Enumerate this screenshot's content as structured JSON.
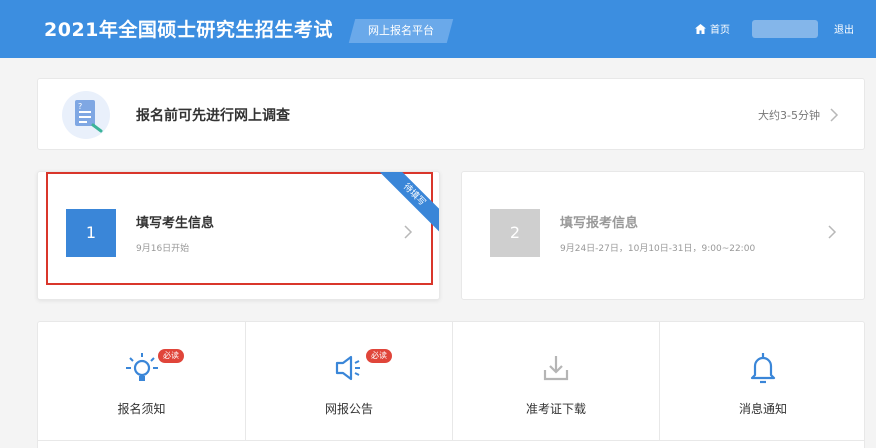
{
  "header": {
    "title": "2021年全国硕士研究生招生考试",
    "badge": "网上报名平台",
    "home": "首页",
    "logout": "退出",
    "bg_color": "#3c8ee0"
  },
  "survey": {
    "text": "报名前可先进行网上调查",
    "time": "大约3-5分钟",
    "icon": "survey-document-icon"
  },
  "steps": [
    {
      "number": "1",
      "title": "填写考生信息",
      "subtitle": "9月16日开始",
      "ribbon": "待填写",
      "color": "#3a86d8"
    },
    {
      "number": "2",
      "title": "填写报考信息",
      "subtitle": "9月24日-27日，10月10日-31日，9:00~22:00",
      "color": "#cfcfcf"
    }
  ],
  "features": [
    {
      "label": "报名须知",
      "tag": "必读",
      "icon": "lightbulb-icon"
    },
    {
      "label": "网报公告",
      "tag": "必读",
      "icon": "megaphone-icon"
    },
    {
      "label": "准考证下载",
      "icon": "download-icon"
    },
    {
      "label": "消息通知",
      "icon": "bell-icon"
    }
  ]
}
